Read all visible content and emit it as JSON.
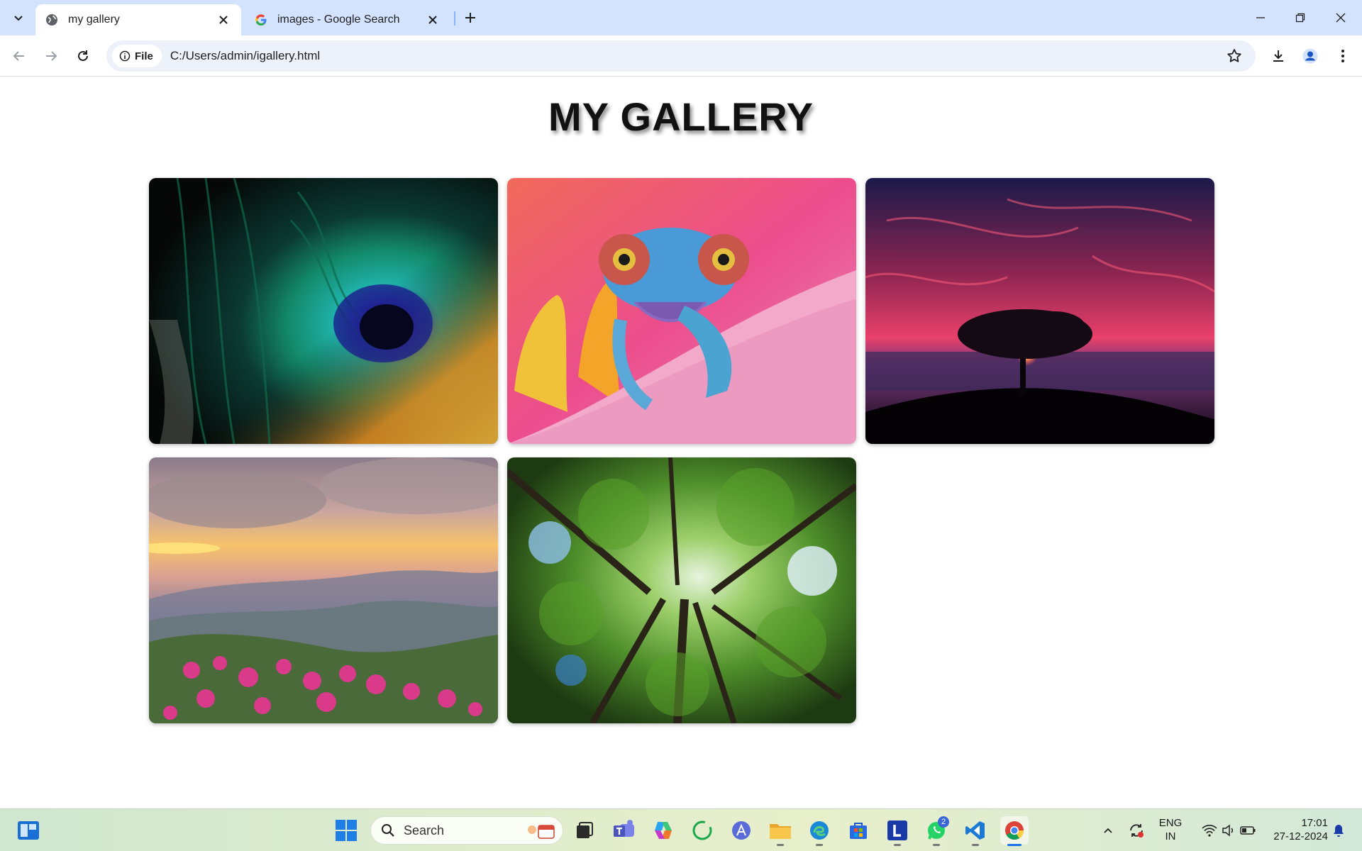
{
  "browser": {
    "tabs": [
      {
        "title": "my gallery",
        "active": true,
        "favicon": "globe-icon"
      },
      {
        "title": "images - Google Search",
        "active": false,
        "favicon": "google-g-icon"
      }
    ],
    "address": {
      "chip_label": "File",
      "url": "C:/Users/admin/igallery.html"
    }
  },
  "page": {
    "title": "MY GALLERY",
    "images": [
      {
        "subject": "peacock-feather"
      },
      {
        "subject": "chameleon-on-flower"
      },
      {
        "subject": "tree-at-sunset"
      },
      {
        "subject": "mountain-sunrise-flowers"
      },
      {
        "subject": "forest-canopy"
      }
    ]
  },
  "taskbar": {
    "search_label": "Search",
    "whatsapp_badge": "2",
    "language": "ENG",
    "region": "IN",
    "time": "17:01",
    "date": "27-12-2024"
  },
  "colors": {
    "tabstrip": "#d3e3fd",
    "omnibox": "#edf2fa",
    "accent": "#1a73e8"
  }
}
